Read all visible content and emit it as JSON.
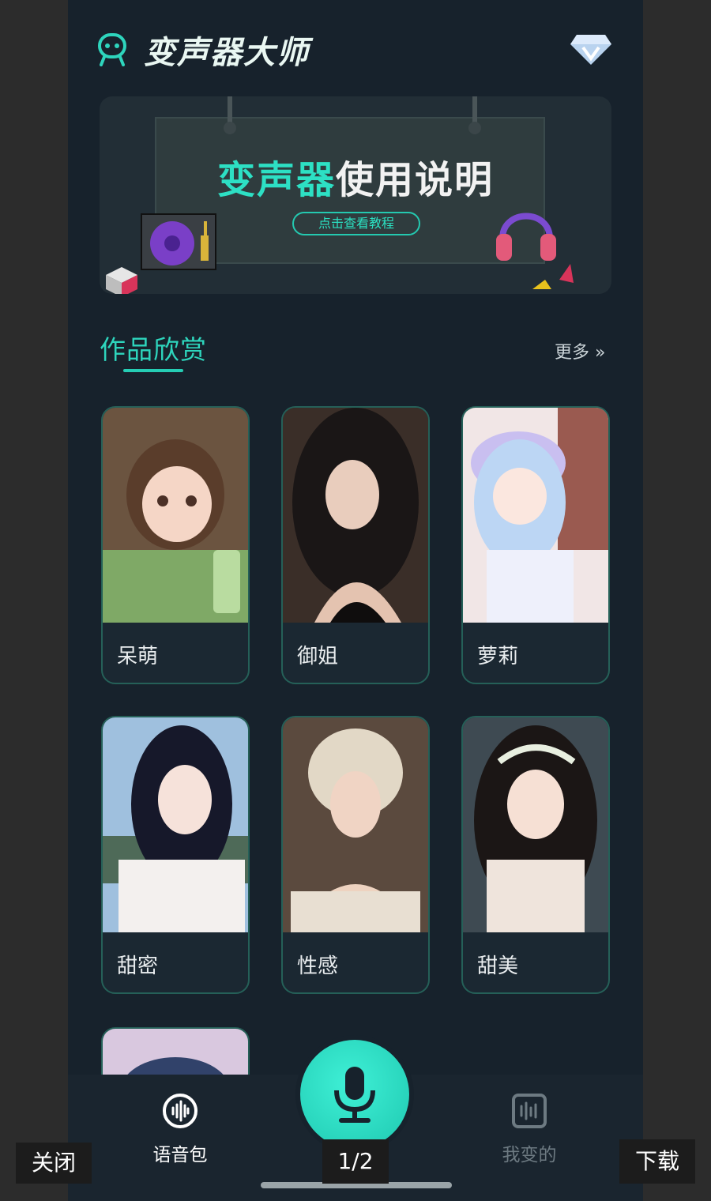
{
  "app": {
    "title": "变声器大师"
  },
  "banner": {
    "title_highlight": "变声器",
    "title_rest": "使用说明",
    "button_label": "点击查看教程"
  },
  "section": {
    "title": "作品欣赏",
    "more_label": "更多 »"
  },
  "cards": [
    {
      "label": "呆萌"
    },
    {
      "label": "御姐"
    },
    {
      "label": "萝莉"
    },
    {
      "label": "甜密"
    },
    {
      "label": "性感"
    },
    {
      "label": "甜美"
    }
  ],
  "bottom_nav": {
    "voice_pack": "语音包",
    "my_changes": "我变的"
  },
  "viewer": {
    "close_label": "关闭",
    "page_indicator": "1/2",
    "download_label": "下载"
  },
  "colors": {
    "accent": "#2ed5bd",
    "background": "#17222c",
    "card_border": "#256058"
  }
}
